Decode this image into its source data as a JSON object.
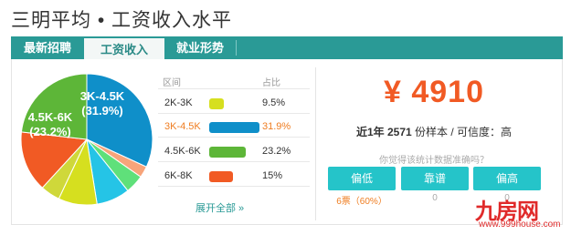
{
  "page": {
    "title": "三明平均 • 工资收入水平"
  },
  "tabs": [
    {
      "label": "最新招聘"
    },
    {
      "label": "工资收入"
    },
    {
      "label": "就业形势"
    }
  ],
  "table": {
    "col_range": "区间",
    "col_share": "占比",
    "rows": [
      {
        "range": "2K-3K",
        "pct": "9.5%",
        "color": "#d6df1f"
      },
      {
        "range": "3K-4.5K",
        "pct": "31.9%",
        "color": "#0f8fc9"
      },
      {
        "range": "4.5K-6K",
        "pct": "23.2%",
        "color": "#5db638"
      },
      {
        "range": "6K-8K",
        "pct": "15%",
        "color": "#f15a24"
      }
    ],
    "show_all": "展开全部 »"
  },
  "pie_labels": {
    "a_range": "3K-4.5K",
    "a_pct": "(31.9%)",
    "b_range": "4.5K-6K",
    "b_pct": "(23.2%)"
  },
  "chart_data": {
    "type": "pie",
    "slices": [
      {
        "label": "3K-4.5K",
        "value": 31.9,
        "color": "#0f8fc9"
      },
      {
        "label": "",
        "value": 2.8,
        "color": "#f7a47a"
      },
      {
        "label": "",
        "value": 4.6,
        "color": "#5fe07a"
      },
      {
        "label": "",
        "value": 8.2,
        "color": "#25c4e6"
      },
      {
        "label": "2K-3K",
        "value": 9.5,
        "color": "#d6df1f"
      },
      {
        "label": "",
        "value": 4.8,
        "color": "#cfd83a"
      },
      {
        "label": "6K-8K",
        "value": 15.0,
        "color": "#f15a24"
      },
      {
        "label": "4.5K-6K",
        "value": 23.2,
        "color": "#5db638"
      }
    ]
  },
  "summary": {
    "salary": "¥ 4910",
    "sample_prefix": "近1年",
    "sample_count": "2571",
    "sample_suffix": "份样本 / 可信度：",
    "confidence": "高",
    "question": "你觉得该统计数据准确吗？"
  },
  "votes": [
    {
      "label": "偏低",
      "count": "6票（60%）"
    },
    {
      "label": "靠谱",
      "count": "0"
    },
    {
      "label": "偏高",
      "count": "0"
    }
  ],
  "watermark": {
    "logo": "九房网",
    "url": "www.999house.com"
  }
}
